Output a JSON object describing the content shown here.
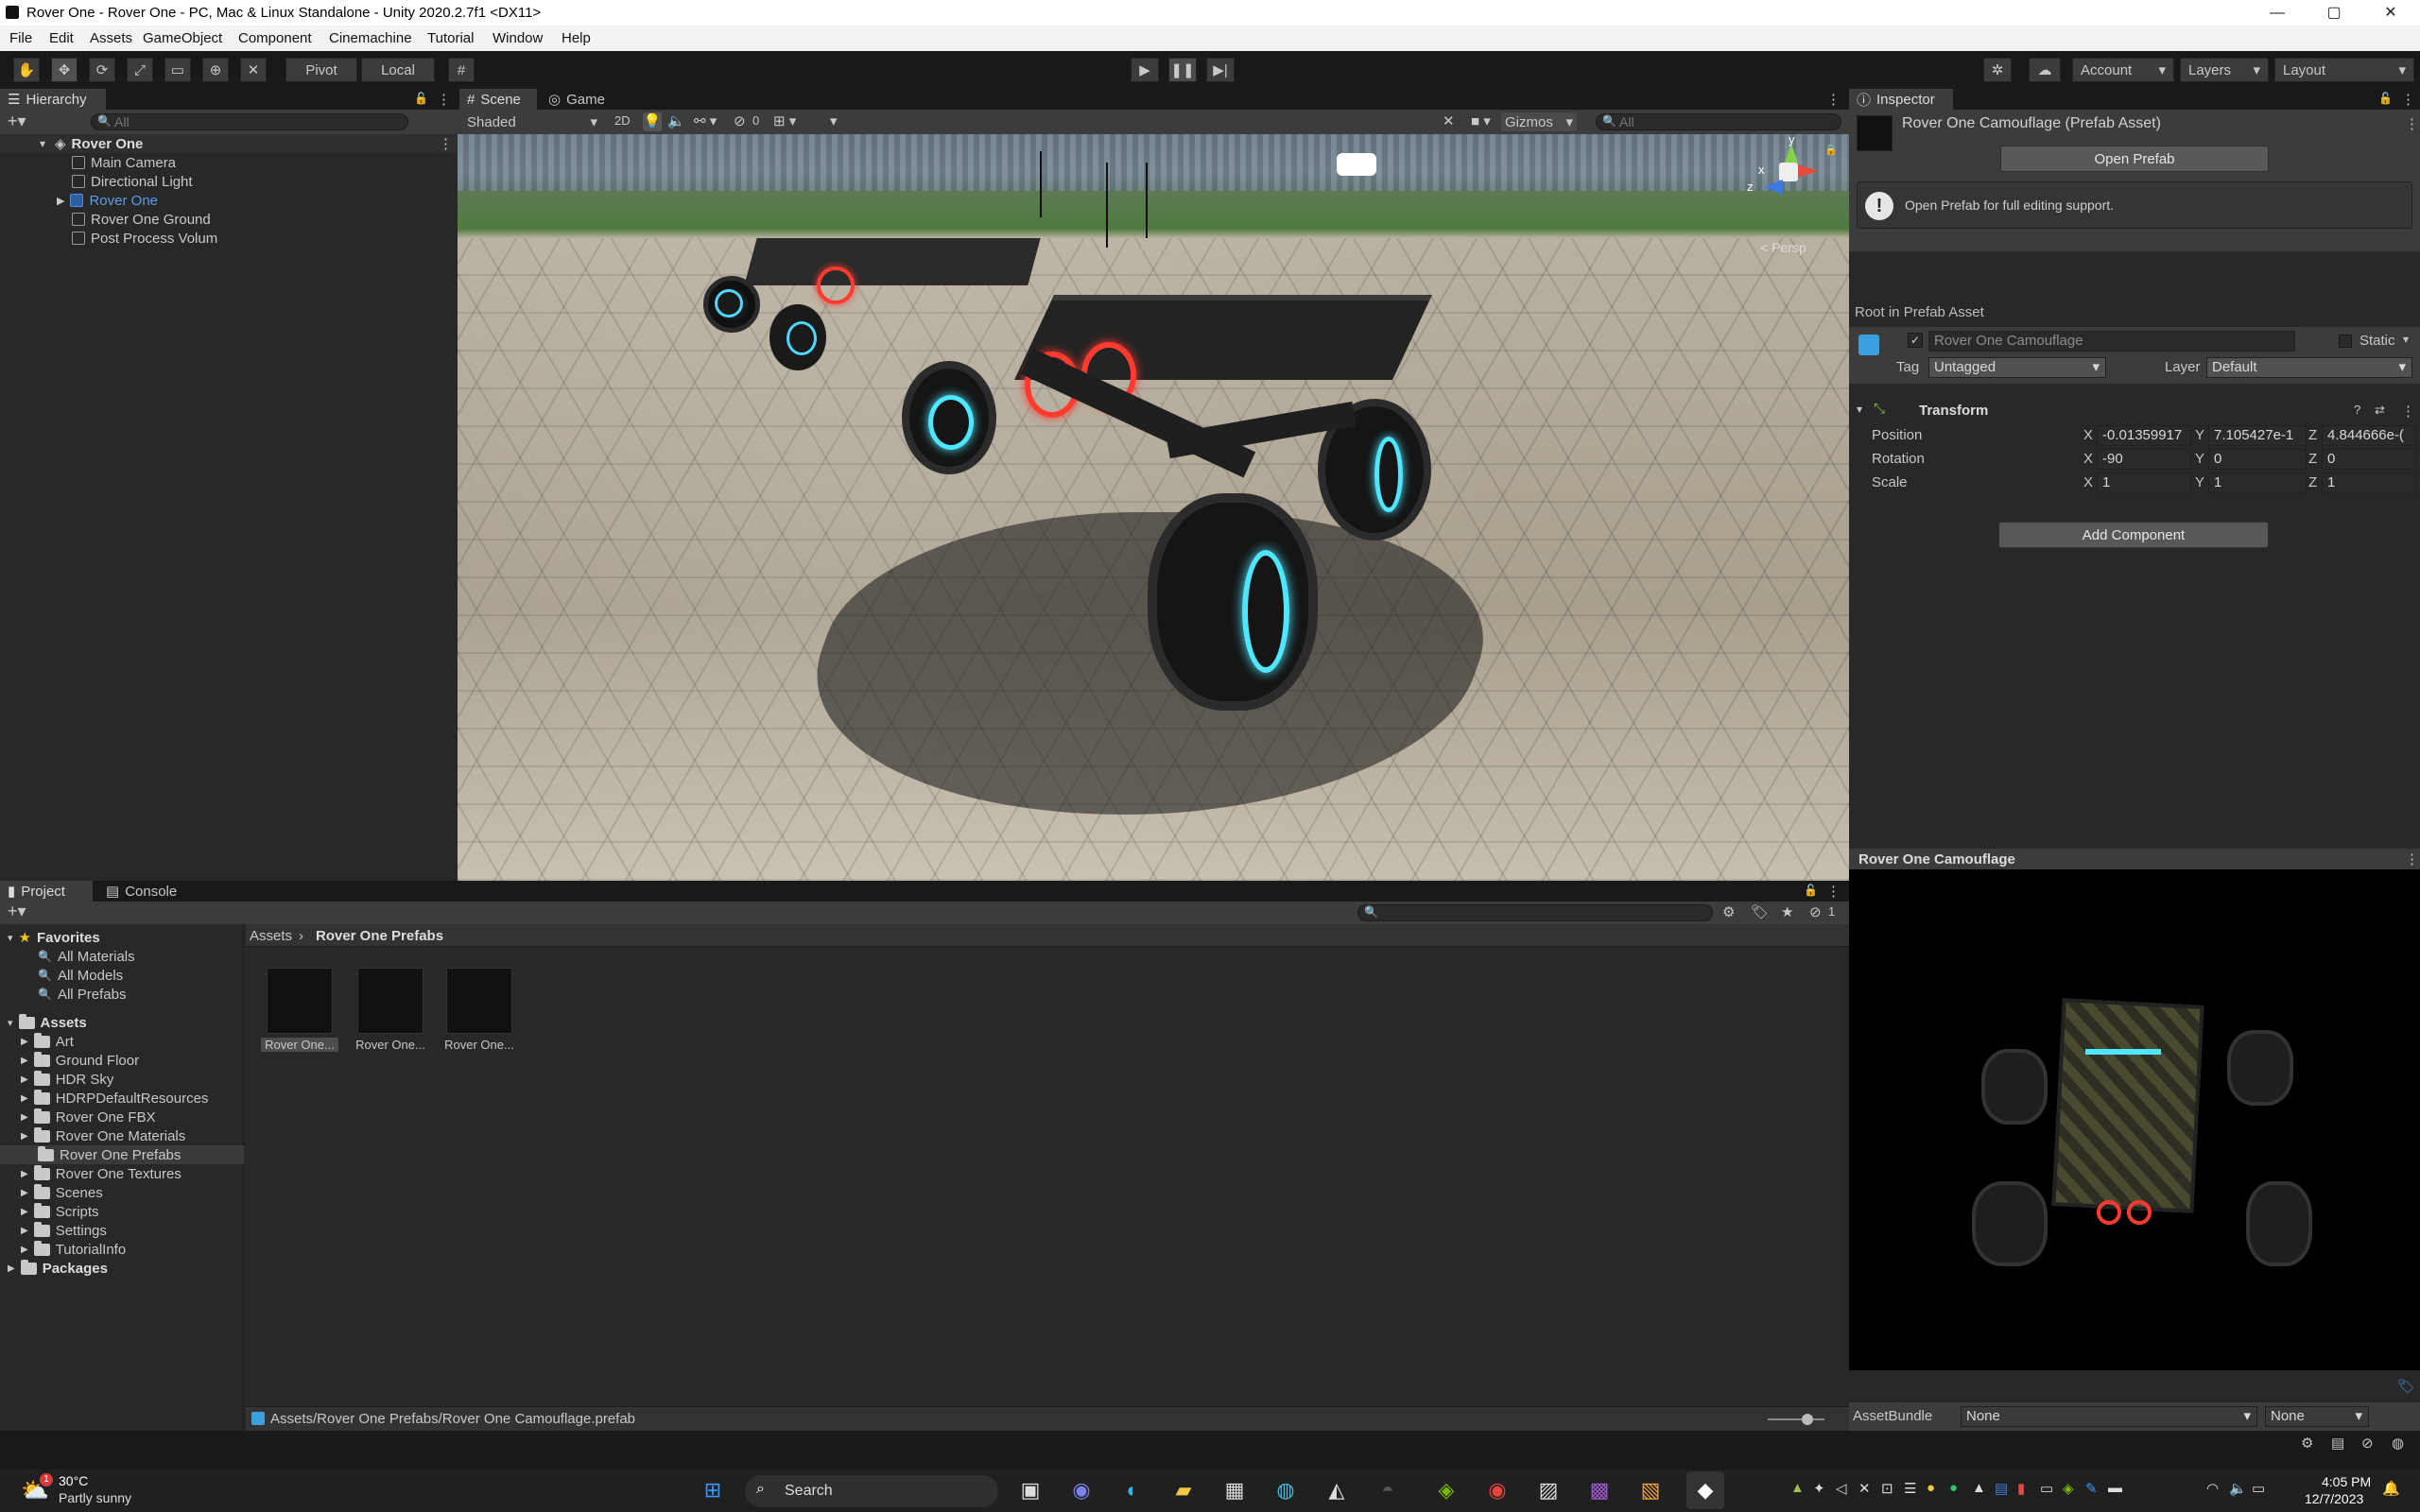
{
  "window": {
    "title": "Rover One - Rover One - PC, Mac & Linux Standalone - Unity 2020.2.7f1 <DX11>",
    "controls": {
      "minimize": "—",
      "maximize": "▢",
      "close": "✕"
    }
  },
  "menu": [
    "File",
    "Edit",
    "Assets",
    "GameObject",
    "Component",
    "Cinemachine",
    "Tutorial",
    "Window",
    "Help"
  ],
  "toolbar": {
    "pivot": "Pivot",
    "local": "Local",
    "account": "Account",
    "layers": "Layers",
    "layout": "Layout"
  },
  "hierarchy": {
    "tab": "Hierarchy",
    "search_placeholder": "All",
    "scene": "Rover One",
    "items": [
      "Main Camera",
      "Directional Light",
      "Rover One",
      "Rover One Ground",
      "Post Process Volum"
    ]
  },
  "scene_view": {
    "tabs": [
      "Scene",
      "Game"
    ],
    "shading": "Shaded",
    "mode_2d": "2D",
    "hidden_count": "0",
    "gizmos": "Gizmos",
    "search_placeholder": "All",
    "persp": "< Persp",
    "axis_x": "x",
    "axis_y": "y",
    "axis_z": "z"
  },
  "inspector": {
    "tab": "Inspector",
    "asset_title": "Rover One Camouflage (Prefab Asset)",
    "open_prefab": "Open Prefab",
    "info": "Open Prefab for full editing support.",
    "root_label": "Root in Prefab Asset",
    "object_name": "Rover One Camouflage",
    "static": "Static",
    "tag_label": "Tag",
    "tag_value": "Untagged",
    "layer_label": "Layer",
    "layer_value": "Default",
    "transform": "Transform",
    "position_label": "Position",
    "rotation_label": "Rotation",
    "scale_label": "Scale",
    "position": {
      "x": "-0.01359917",
      "y": "7.105427e-1",
      "z": "4.844666e-("
    },
    "rotation": {
      "x": "-90",
      "y": "0",
      "z": "0"
    },
    "scale": {
      "x": "1",
      "y": "1",
      "z": "1"
    },
    "add_component": "Add Component",
    "preview_title": "Rover One Camouflage",
    "assetbundle_label": "AssetBundle",
    "assetbundle_value": "None",
    "assetbundle_variant": "None"
  },
  "project": {
    "tabs": [
      "Project",
      "Console"
    ],
    "hidden_count": "1",
    "favorites": "Favorites",
    "favorite_items": [
      "All Materials",
      "All Models",
      "All Prefabs"
    ],
    "assets": "Assets",
    "folders": [
      "Art",
      "Ground Floor",
      "HDR Sky",
      "HDRPDefaultResources",
      "Rover One FBX",
      "Rover One Materials",
      "Rover One Prefabs",
      "Rover One Textures",
      "Scenes",
      "Scripts",
      "Settings",
      "TutorialInfo"
    ],
    "packages": "Packages",
    "breadcrumb": [
      "Assets",
      "Rover One Prefabs"
    ],
    "thumbs": [
      "Rover One...",
      "Rover One...",
      "Rover One..."
    ],
    "status_path": "Assets/Rover One Prefabs/Rover One Camouflage.prefab"
  },
  "taskbar": {
    "weather_temp": "30°C",
    "weather_desc": "Partly sunny",
    "search": "Search",
    "time": "4:05 PM",
    "date": "12/7/2023",
    "notification_badge": "1"
  },
  "colors": {
    "accent_blue": "#2f6fbe",
    "selected_text": "#5d9be6",
    "panel_bg": "#282828"
  }
}
